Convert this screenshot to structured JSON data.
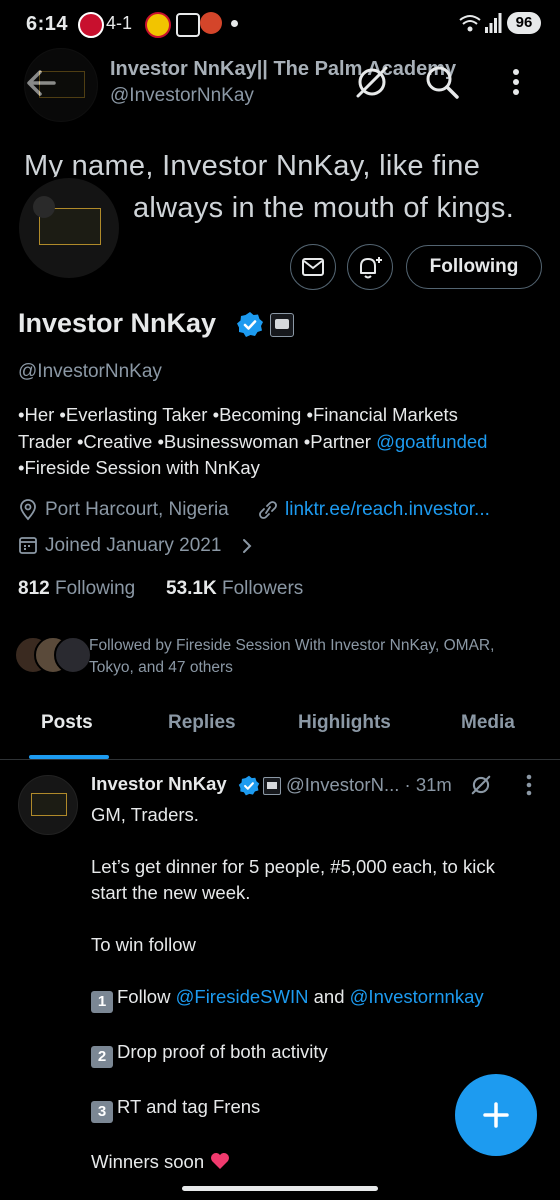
{
  "status_bar": {
    "time": "6:14",
    "score": "4-1",
    "battery": "96"
  },
  "header": {
    "title": "Investor NnKay|| The Palm Academy",
    "handle": "@InvestorNnKay"
  },
  "banner": {
    "line1": "My name, Investor NnKay, like fine",
    "line2": "always in the mouth of kings."
  },
  "actions": {
    "following_label": "Following"
  },
  "profile": {
    "name": "Investor NnKay",
    "handle": "@InvestorNnKay",
    "bio_line1": "•Her •Everlasting Taker •Becoming •Financial Markets",
    "bio_line2_pre": "Trader •Creative •Businesswoman •Partner ",
    "bio_mention": "@goatfunded",
    "bio_line3": "•Fireside Session with NnKay",
    "location": "Port Harcourt, Nigeria",
    "website": "linktr.ee/reach.investor...",
    "joined": "Joined January 2021",
    "following_count": "812",
    "following_label": "Following",
    "followers_count": "53.1K",
    "followers_label": "Followers",
    "followed_by_line1": "Followed by Fireside Session With Investor NnKay, OMAR,",
    "followed_by_line2": "Tokyo, and 47 others"
  },
  "tabs": [
    "Posts",
    "Replies",
    "Highlights",
    "Media"
  ],
  "post": {
    "author": "Investor NnKay",
    "handle": "@InvestorN...",
    "time": "· 31m",
    "line1": "GM, Traders.",
    "line2": "Let’s get dinner for 5 people, #5,000 each, to kick",
    "line3": "start the new week.",
    "line4": "To win follow",
    "step1_num": "1",
    "step1_pre": "Follow ",
    "step1_mention1": "@FiresideSWIN",
    "step1_mid": " and ",
    "step1_mention2": "@Investornnkay",
    "step2_num": "2",
    "step2": "Drop proof of both activity",
    "step3_num": "3",
    "step3": "RT and tag Frens",
    "closing": "Winners soon"
  },
  "colors": {
    "accent": "#1d9bf0",
    "muted": "#8b98a5",
    "border": "#536471"
  }
}
